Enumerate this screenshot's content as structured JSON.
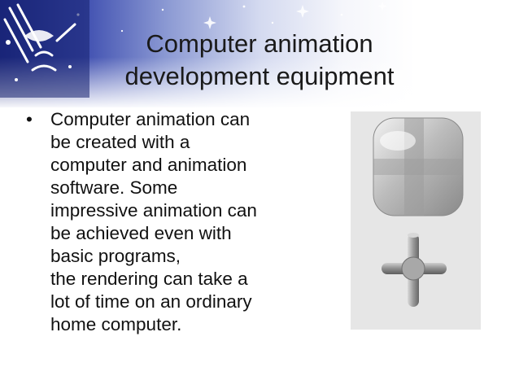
{
  "slide": {
    "title_line1": "Computer animation",
    "title_line2": "development equipment",
    "bullet_symbol": "•",
    "bullet_text": "Computer animation can\nbe created with a\ncomputer and animation\nsoftware. Some\nimpressive animation can\nbe achieved even with\nbasic programs,\nthe rendering can take a\nlot of time on an ordinary\nhome computer."
  },
  "colors": {
    "banner_dark": "#1d2a86",
    "text": "#111111",
    "figure_bg": "#e6e6e6"
  },
  "icons": {
    "logo": "satellite-dish-logo",
    "stars": "star-sparkle-icons",
    "figure": "3d-rendered-cube-and-cross-image"
  }
}
